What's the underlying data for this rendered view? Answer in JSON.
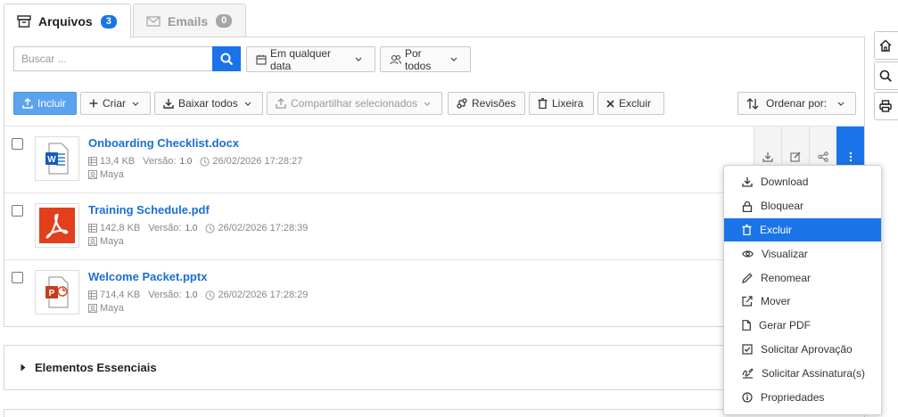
{
  "tabs": [
    {
      "label": "Arquivos",
      "badge": "3",
      "active": true
    },
    {
      "label": "Emails",
      "badge": "0",
      "active": false
    }
  ],
  "search": {
    "placeholder": "Buscar ..."
  },
  "filters": {
    "date": "Em qualquer data",
    "people": "Por todos"
  },
  "toolbar": {
    "include": "Incluir",
    "create": "Criar",
    "download_all": "Baixar todos",
    "share_selected": "Compartilhar selecionados",
    "revisions": "Revisões",
    "trash": "Lixeira",
    "delete": "Excluir",
    "sort": "Ordenar por:"
  },
  "files": [
    {
      "name": "Onboarding Checklist.docx",
      "size": "13,4 KB",
      "version_label": "Versão:",
      "version": "1.0",
      "date": "26/02/2026 17:28:27",
      "owner": "Maya",
      "type": "docx"
    },
    {
      "name": "Training Schedule.pdf",
      "size": "142,8 KB",
      "version_label": "Versão:",
      "version": "1.0",
      "date": "26/02/2026 17:28:39",
      "owner": "Maya",
      "type": "pdf"
    },
    {
      "name": "Welcome Packet.pptx",
      "size": "714,4 KB",
      "version_label": "Versão:",
      "version": "1.0",
      "date": "26/02/2026 17:28:29",
      "owner": "Maya",
      "type": "pptx"
    }
  ],
  "section": {
    "title": "Elementos Essenciais"
  },
  "menu": {
    "items": [
      {
        "label": "Download",
        "icon": "download-icon"
      },
      {
        "label": "Bloquear",
        "icon": "lock-icon"
      },
      {
        "label": "Excluir",
        "icon": "trash-icon",
        "active": true
      },
      {
        "label": "Visualizar",
        "icon": "eye-icon"
      },
      {
        "label": "Renomear",
        "icon": "pencil-icon"
      },
      {
        "label": "Mover",
        "icon": "external-link-icon"
      },
      {
        "label": "Gerar PDF",
        "icon": "file-icon"
      },
      {
        "label": "Solicitar Aprovação",
        "icon": "check-square-icon"
      },
      {
        "label": "Solicitar Assinatura(s)",
        "icon": "signature-icon"
      },
      {
        "label": "Propriedades",
        "icon": "info-icon"
      }
    ]
  },
  "colors": {
    "accent": "#1a73e8",
    "primary_button": "#5ba3ef",
    "link": "#1a6fd3"
  }
}
